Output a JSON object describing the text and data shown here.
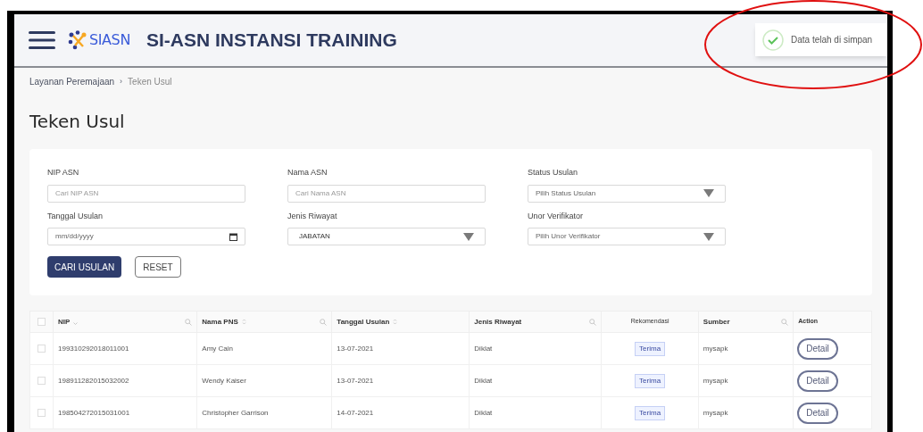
{
  "header": {
    "logo_text": "SIASN",
    "title": "SI-ASN INSTANSI TRAINING"
  },
  "toast": {
    "message": "Data telah di simpan"
  },
  "breadcrumb": [
    {
      "label": "Layanan Peremajaan"
    },
    {
      "label": "Teken Usul"
    }
  ],
  "breadcrumb_separator": "›",
  "page_title": "Teken Usul",
  "filters": [
    {
      "kind": "text",
      "label": "NIP ASN",
      "placeholder": "Cari NIP ASN"
    },
    {
      "kind": "text",
      "label": "Nama ASN",
      "placeholder": "Cari Nama ASN"
    },
    {
      "kind": "select",
      "label": "Status Usulan",
      "placeholder": "Pilih Status Usulan"
    },
    {
      "kind": "date",
      "label": "Tanggal Usulan",
      "placeholder": "mm/dd/yyyy"
    },
    {
      "kind": "select",
      "label": "Jenis Riwayat",
      "value": "JABATAN"
    },
    {
      "kind": "select",
      "label": "Unor Verifikator",
      "placeholder": "Pilih Unor Verifikator"
    }
  ],
  "buttons": [
    {
      "kind": "primary",
      "label": "CARI USULAN"
    },
    {
      "kind": "outline",
      "label": "RESET"
    }
  ],
  "table": {
    "select_all_checked": false,
    "columns": [
      {
        "label": "NIP",
        "sortable": true,
        "sorted": true,
        "searchable": true
      },
      {
        "label": "Nama PNS",
        "sortable": true,
        "sorted": false,
        "searchable": true
      },
      {
        "label": "Tanggal Usulan",
        "sortable": true,
        "sorted": false,
        "searchable": false
      },
      {
        "label": "Jenis Riwayat",
        "sortable": false,
        "sorted": false,
        "searchable": true
      },
      {
        "label": "Rekomendasi",
        "sortable": false,
        "sorted": false,
        "searchable": false
      },
      {
        "label": "Sumber",
        "sortable": false,
        "sorted": false,
        "searchable": true
      },
      {
        "label": "Action",
        "sortable": false,
        "sorted": false,
        "searchable": false
      }
    ],
    "rows": [
      {
        "checked": false,
        "nip": "199310292018011001",
        "nama": "Amy Cain",
        "tanggal": "13-07-2021",
        "jenis": "Diklat",
        "rekomendasi": "Terima",
        "sumber": "mysapk",
        "action": "Detail"
      },
      {
        "checked": false,
        "nip": "198911282015032002",
        "nama": "Wendy Kaiser",
        "tanggal": "13-07-2021",
        "jenis": "Diklat",
        "rekomendasi": "Terima",
        "sumber": "mysapk",
        "action": "Detail"
      },
      {
        "checked": false,
        "nip": "198504272015031001",
        "nama": "Christopher Garrison",
        "tanggal": "14-07-2021",
        "jenis": "Diklat",
        "rekomendasi": "Terima",
        "sumber": "mysapk",
        "action": "Detail"
      }
    ]
  }
}
